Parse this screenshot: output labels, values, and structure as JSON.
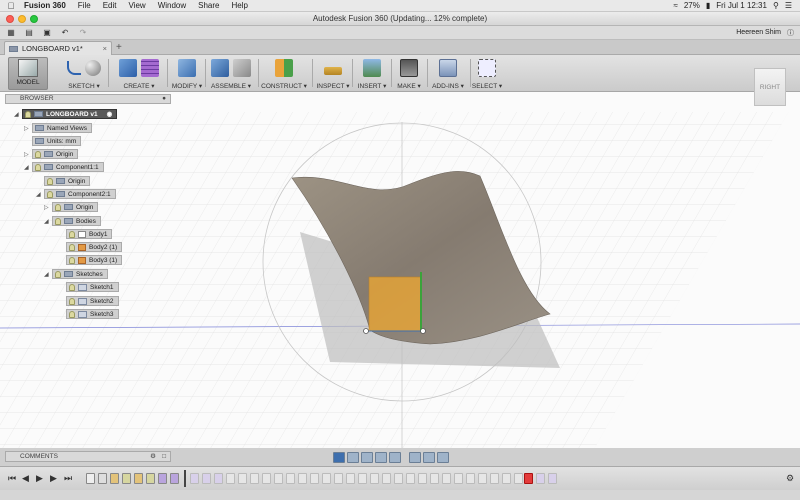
{
  "menubar": {
    "app_name": "Fusion 360",
    "items": [
      "File",
      "Edit",
      "View",
      "Window",
      "Share",
      "Help"
    ],
    "battery": "27%",
    "datetime": "Fri Jul 1  12:31"
  },
  "window": {
    "title": "Autodesk Fusion 360  (Updating... 12% complete)"
  },
  "toolbar": {
    "user": "Heereen Shim"
  },
  "tabs": [
    {
      "label": "LONGBOARD v1*"
    }
  ],
  "ribbon": {
    "model": "MODEL",
    "groups": [
      "SKETCH",
      "CREATE",
      "MODIFY",
      "ASSEMBLE",
      "CONSTRUCT",
      "INSPECT",
      "INSERT",
      "MAKE",
      "ADD-INS",
      "SELECT"
    ]
  },
  "browser": {
    "title": "BROWSER",
    "root": "LONGBOARD v1",
    "named_views": "Named Views",
    "units": "Units: mm",
    "origin": "Origin",
    "component1": "Component1:1",
    "component1_origin": "Origin",
    "component2": "Component2:1",
    "component2_origin": "Origin",
    "bodies": "Bodies",
    "body1": "Body1",
    "body2": "Body2 (1)",
    "body3": "Body3 (1)",
    "sketches": "Sketches",
    "sketch1": "Sketch1",
    "sketch2": "Sketch2",
    "sketch3": "Sketch3"
  },
  "viewcube": {
    "face": "RIGHT"
  },
  "comments": {
    "title": "COMMENTS"
  },
  "colors": {
    "surface": "#8e857a",
    "selection_box": "#f0a830",
    "accent_blue": "#3e6fae"
  }
}
